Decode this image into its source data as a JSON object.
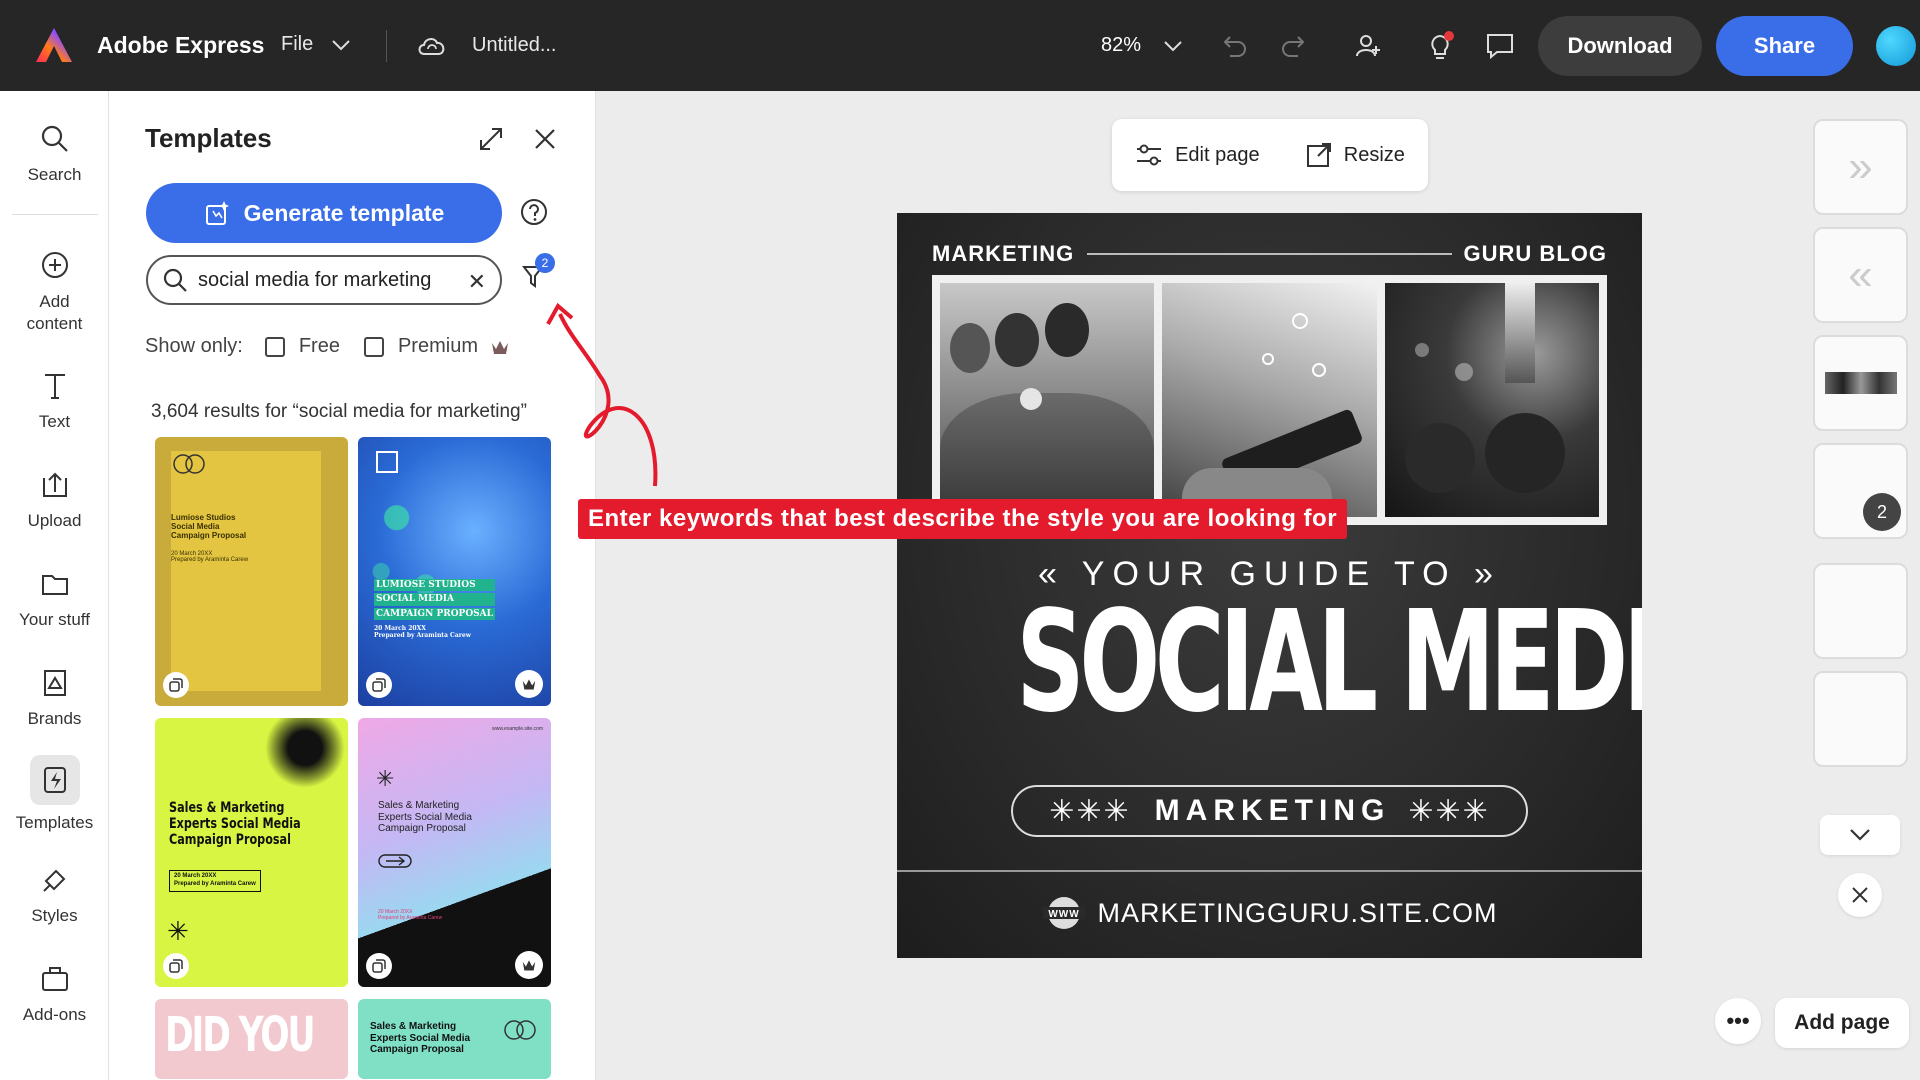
{
  "topbar": {
    "app_title": "Adobe Express",
    "file_label": "File",
    "doc_title": "Untitled...",
    "zoom": "82%",
    "download_label": "Download",
    "share_label": "Share",
    "colors": {
      "bg": "#262626",
      "share": "#3a6de8"
    }
  },
  "rail": {
    "items": [
      {
        "label": "Search",
        "icon": "search-icon"
      },
      {
        "label": "Add content",
        "icon": "plus-circle-icon"
      },
      {
        "label": "Text",
        "icon": "text-icon"
      },
      {
        "label": "Upload",
        "icon": "upload-icon"
      },
      {
        "label": "Your stuff",
        "icon": "folder-icon"
      },
      {
        "label": "Brands",
        "icon": "brands-icon"
      },
      {
        "label": "Templates",
        "icon": "templates-icon"
      },
      {
        "label": "Styles",
        "icon": "styles-icon"
      },
      {
        "label": "Add-ons",
        "icon": "addons-icon"
      }
    ],
    "active": "Templates"
  },
  "panel": {
    "title": "Templates",
    "generate_label": "Generate template",
    "search_value": "social media for marketing",
    "filter_count": "2",
    "show_only_label": "Show only:",
    "free_label": "Free",
    "premium_label": "Premium",
    "results_text": "3,604 results for “social media for marketing”",
    "templates": [
      {
        "lines": [
          "Lumiose Studios",
          "Social Media",
          "Campaign Proposal"
        ],
        "sub": "20 March 20XX",
        "sub2": "Prepared by Araminta Carew",
        "bg": "#c9ab3c"
      },
      {
        "lines": [
          "LUMIOSE STUDIOS",
          "SOCIAL MEDIA",
          "CAMPAIGN PROPOSAL"
        ],
        "sub": "20 March 20XX",
        "sub2": "Prepared by Araminta Carew",
        "bg": "#1f5fc7"
      },
      {
        "lines": [
          "Sales & Marketing",
          "Experts Social Media",
          "Campaign Proposal"
        ],
        "sub": "20 March 20XX",
        "sub2": "Prepared by Araminta Carew",
        "bg": "#d8f543"
      },
      {
        "lines": [
          "Sales & Marketing",
          "Experts Social Media",
          "Campaign Proposal"
        ],
        "sub": "20 March 20XX",
        "sub2": "Prepared by Araminta Carew",
        "url": "www.example.site.com",
        "bg": "#e7b5e8"
      },
      {
        "lines": [
          "DID YOU"
        ],
        "bg": "#f1c9ce"
      },
      {
        "lines": [
          "Sales & Marketing",
          "Experts Social Media",
          "Campaign Proposal"
        ],
        "bg": "#7fe0c6"
      }
    ]
  },
  "edit_bar": {
    "edit_label": "Edit page",
    "resize_label": "Resize"
  },
  "design": {
    "header_left": "MARKETING",
    "header_right": "GURU BLOG",
    "guide_text": "YOUR GUIDE TO",
    "big_text": "SOCIAL MEDIA",
    "pill_text": "MARKETING",
    "url_text": "MARKETINGGURU.SITE.COM",
    "www_label": "WWW"
  },
  "annotation": {
    "text": "Enter keywords that best describe the style you are looking for",
    "color": "#e31b2c"
  },
  "pages": {
    "badge": "2",
    "add_page_label": "Add page"
  }
}
